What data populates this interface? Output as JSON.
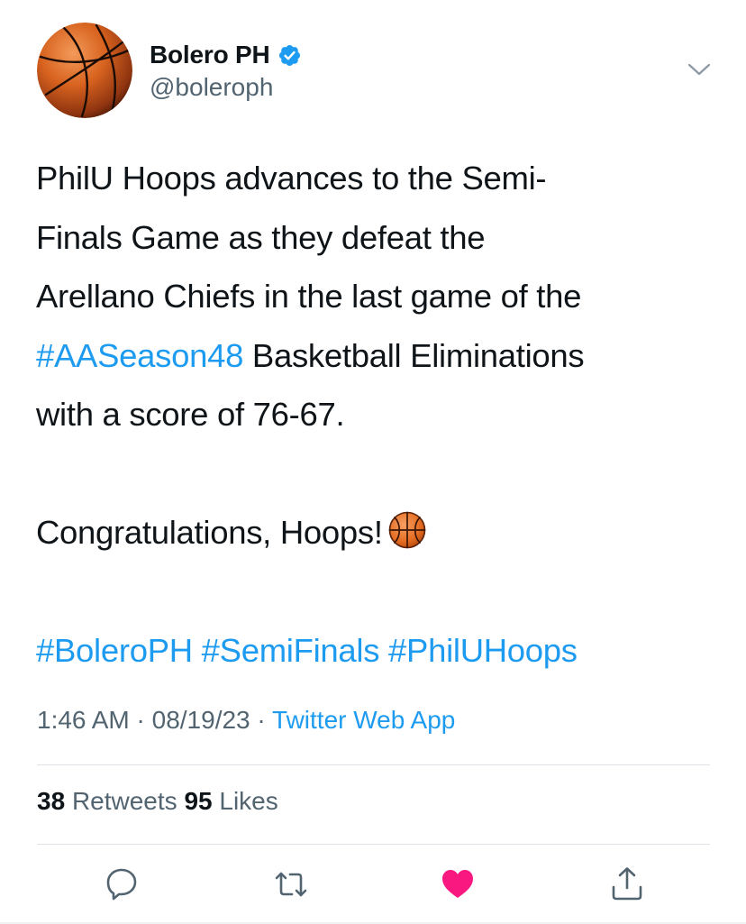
{
  "user": {
    "display_name": "Bolero PH",
    "handle": "@boleroph",
    "verified_icon": "verified-badge-icon",
    "avatar_icon": "basketball-icon"
  },
  "tweet": {
    "line_1": "PhilU Hoops advances to the Semi-",
    "line_2": "Finals Game as they defeat the",
    "line_3": "Arellano Chiefs in the last game of the",
    "hashtag_season": "#AASeason48",
    "line_4_rest": " Basketball Eliminations",
    "line_5": "with a score of 76-67.",
    "congrats": "Congratulations, Hoops!",
    "congrats_emoji": "basketball-emoji",
    "hashtags": [
      "#BoleroPH",
      "#SemiFinals",
      "#PhilUHoops"
    ]
  },
  "meta": {
    "time": "1:46 AM",
    "separator": " · ",
    "date": "08/19/23",
    "source": "Twitter Web App"
  },
  "stats": {
    "retweets_count": "38",
    "retweets_label": "Retweets",
    "likes_count": "95",
    "likes_label": "Likes"
  },
  "actions": {
    "reply_icon": "reply-icon",
    "retweet_icon": "retweet-icon",
    "like_icon": "heart-icon",
    "share_icon": "share-icon",
    "liked": true
  },
  "colors": {
    "link": "#1d9bf0",
    "secondary_text": "#536471",
    "primary_text": "#0f1419",
    "like": "#f91880",
    "divider": "#dfe3e7"
  }
}
